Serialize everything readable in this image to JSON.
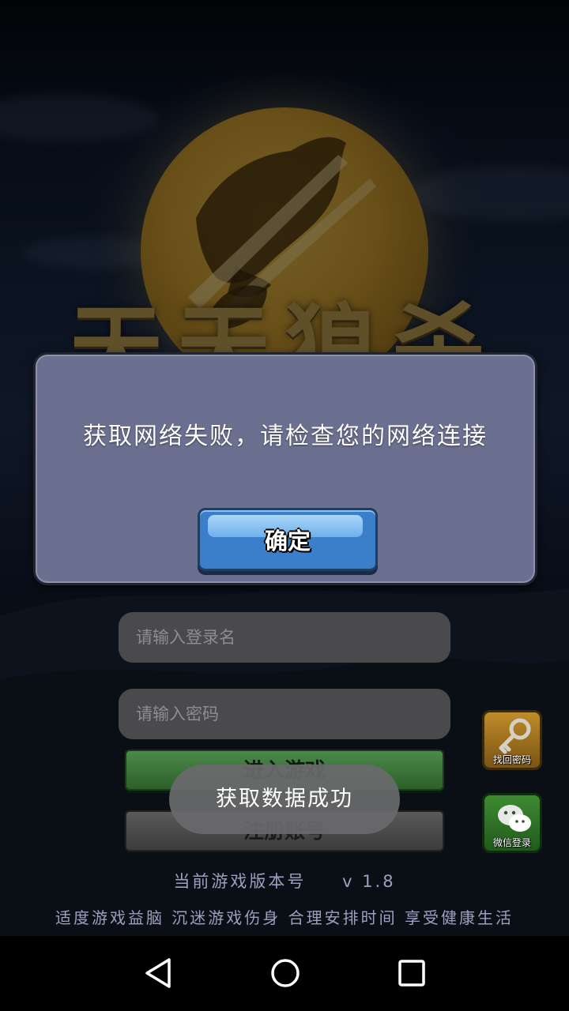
{
  "game": {
    "logo_text": "天天狼杀"
  },
  "dialog": {
    "message": "获取网络失败，请检查您的网络连接",
    "confirm_label": "确定"
  },
  "login": {
    "username_placeholder": "请输入登录名",
    "password_placeholder": "请输入密码",
    "start_label": "进入游戏",
    "register_label": "注册账号"
  },
  "toast": {
    "message": "获取数据成功"
  },
  "side_buttons": {
    "find_password_label": "找回密码",
    "wechat_login_label": "微信登录"
  },
  "footer": {
    "version_label": "当前游戏版本号",
    "version_number": "v 1.8",
    "health_notice": "适度游戏益脑 沉迷游戏伤身 合理安排时间 享受健康生活"
  },
  "navbar": {
    "back_icon": "triangle-back-icon",
    "home_icon": "circle-home-icon",
    "recents_icon": "square-recents-icon"
  },
  "colors": {
    "dialog_bg": "#6b7090",
    "confirm_button": "#3b7ec9",
    "start_button": "#3d7a3a",
    "moon": "#c9982e"
  }
}
